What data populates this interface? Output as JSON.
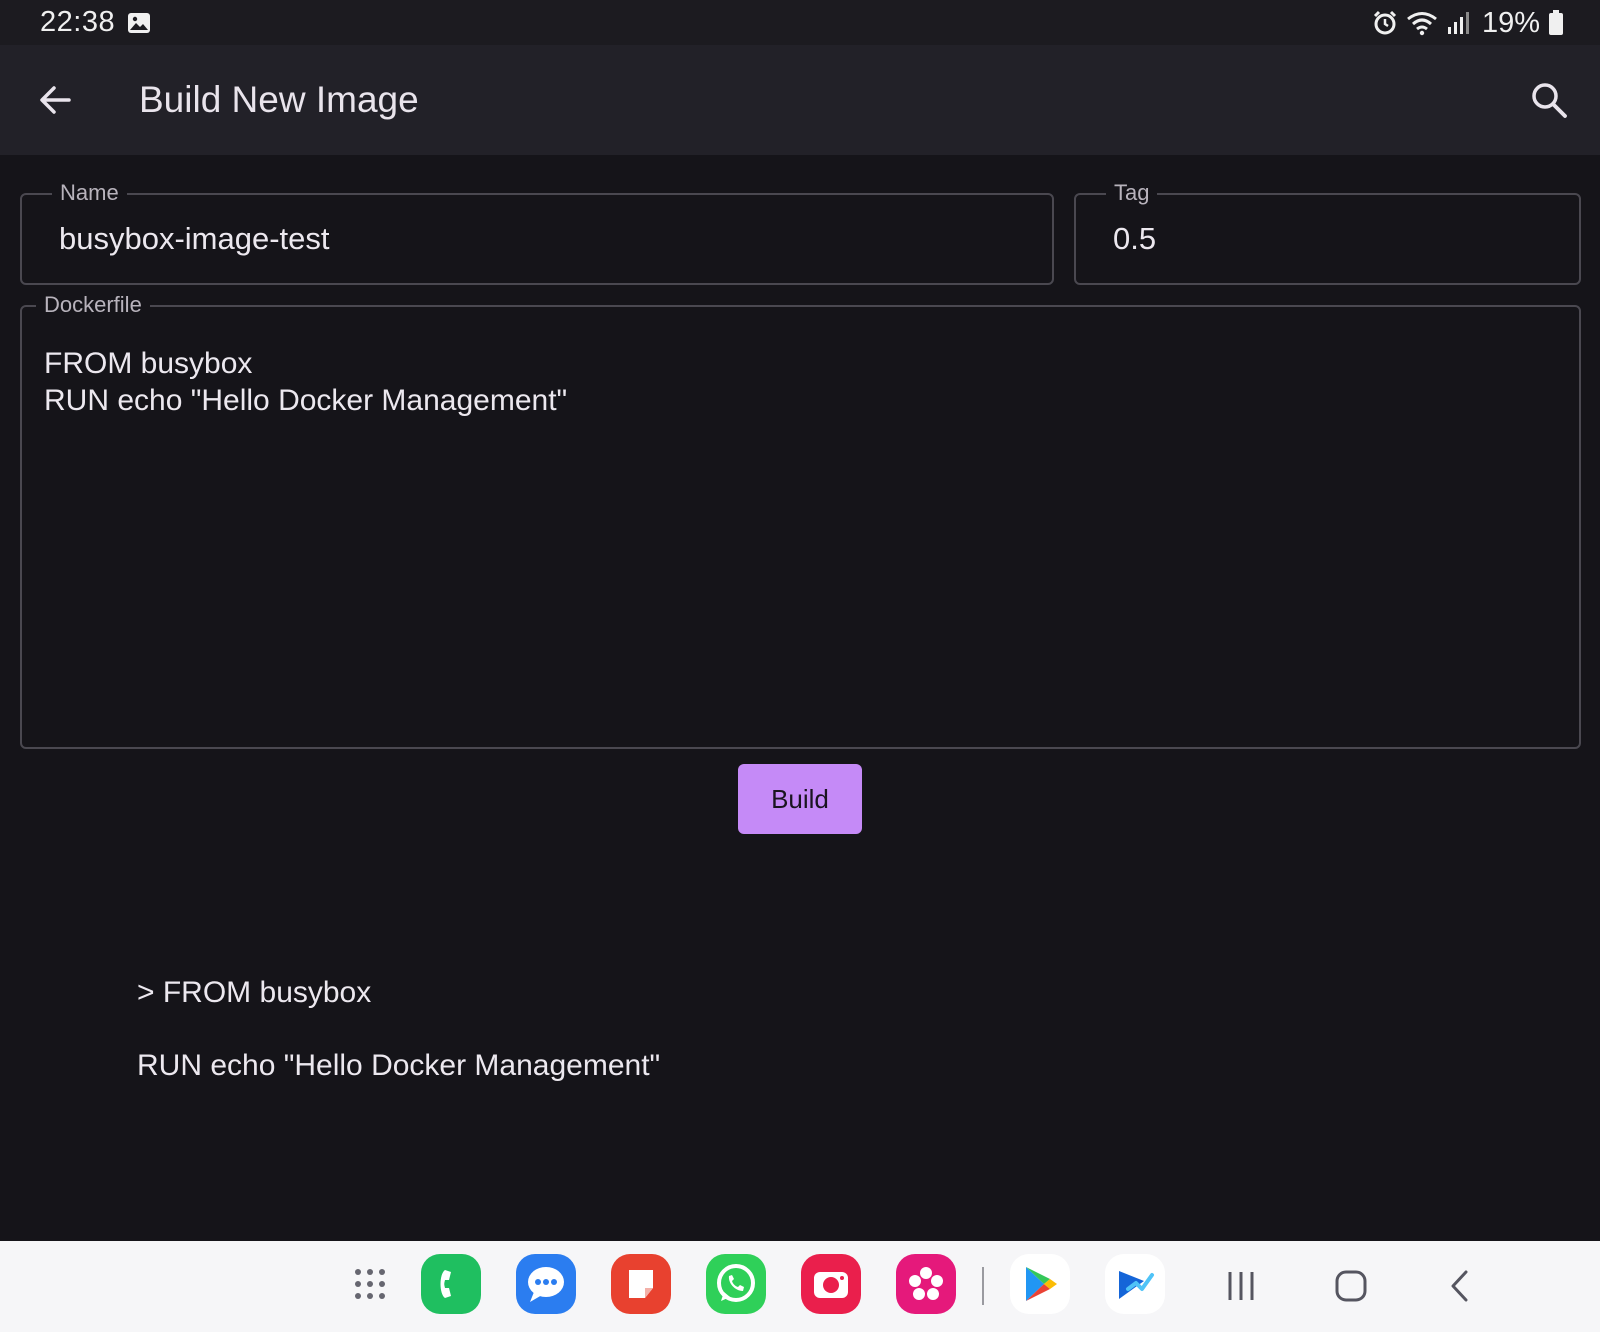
{
  "status_bar": {
    "time": "22:38",
    "battery": "19%",
    "icons": [
      "photo-icon",
      "alarm-icon",
      "wifi-icon",
      "signal-icon",
      "battery-icon"
    ]
  },
  "app_bar": {
    "title": "Build New Image",
    "back_icon": "arrow-left-icon",
    "search_icon": "search-icon"
  },
  "form": {
    "name": {
      "label": "Name",
      "value": "busybox-image-test"
    },
    "tag": {
      "label": "Tag",
      "value": "0.5"
    },
    "dockerfile": {
      "label": "Dockerfile",
      "lines": [
        "FROM busybox",
        "RUN echo \"Hello Docker Management\""
      ]
    },
    "build_label": "Build"
  },
  "output": {
    "lines": [
      "> FROM busybox",
      "RUN echo \"Hello Docker Management\""
    ]
  },
  "colors": {
    "background": "#151419",
    "app_bar": "#222128",
    "accent": "#c58af7"
  },
  "taskbar": {
    "apps": [
      "apps-grid-icon",
      "phone-app-icon",
      "messages-app-icon",
      "notes-app-icon",
      "whatsapp-app-icon",
      "camera-app-icon",
      "gallery-app-icon",
      "play-store-icon",
      "docker-app-icon"
    ],
    "nav": [
      "recents-icon",
      "home-icon",
      "back-nav-icon"
    ]
  }
}
